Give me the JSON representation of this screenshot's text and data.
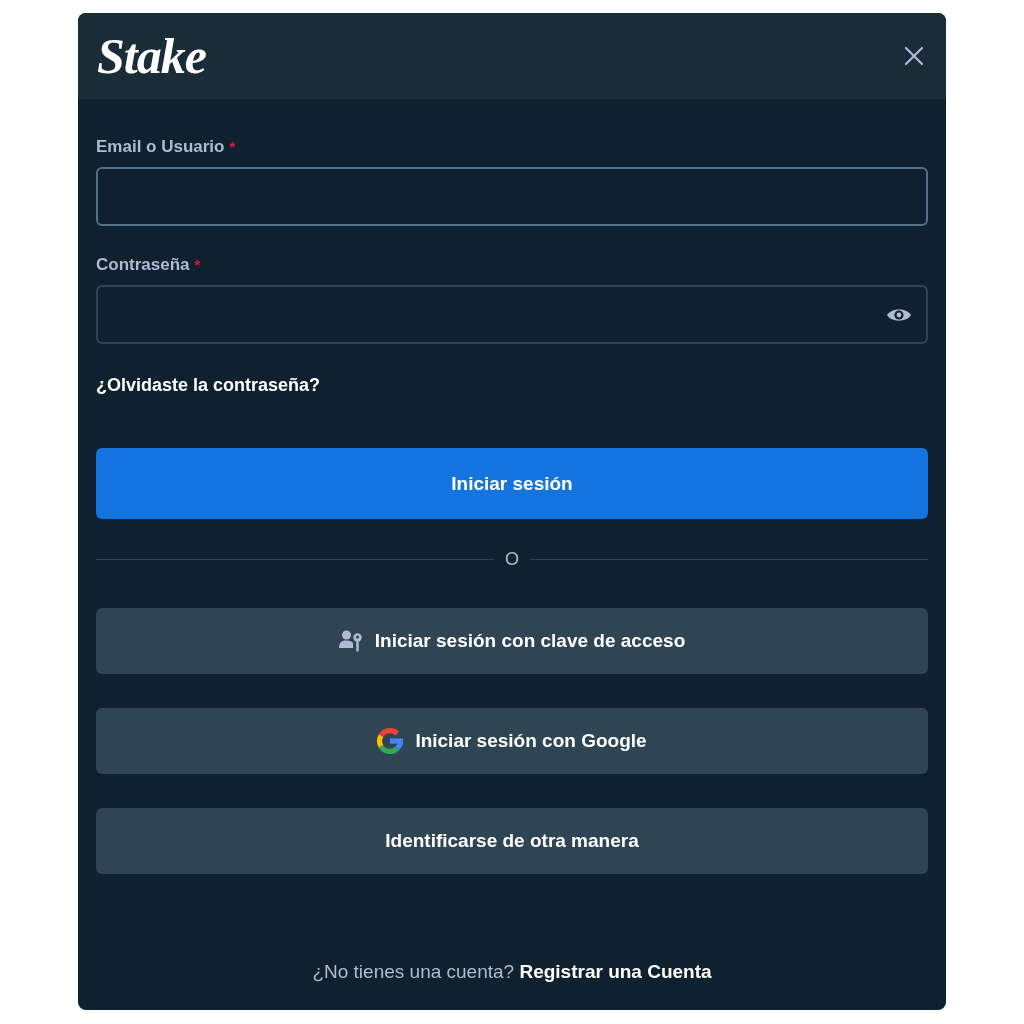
{
  "header": {
    "logo": "Stake"
  },
  "fields": [
    {
      "kind": "text",
      "label": "Email o Usuario",
      "required_mark": "*",
      "focused": true
    },
    {
      "kind": "password",
      "label": "Contraseña",
      "required_mark": "*",
      "focused": false
    }
  ],
  "forgot_link": "¿Olvidaste la contraseña?",
  "primary_button": "Iniciar sesión",
  "divider_text": "O",
  "alt_buttons": [
    {
      "kind": "passkey",
      "label": "Iniciar sesión con clave de acceso"
    },
    {
      "kind": "google",
      "label": "Iniciar sesión con Google"
    },
    {
      "kind": "plain",
      "label": "Identificarse de otra manera"
    }
  ],
  "footer": {
    "prompt": "¿No tienes una cuenta?",
    "link": "Registrar una Cuenta"
  }
}
